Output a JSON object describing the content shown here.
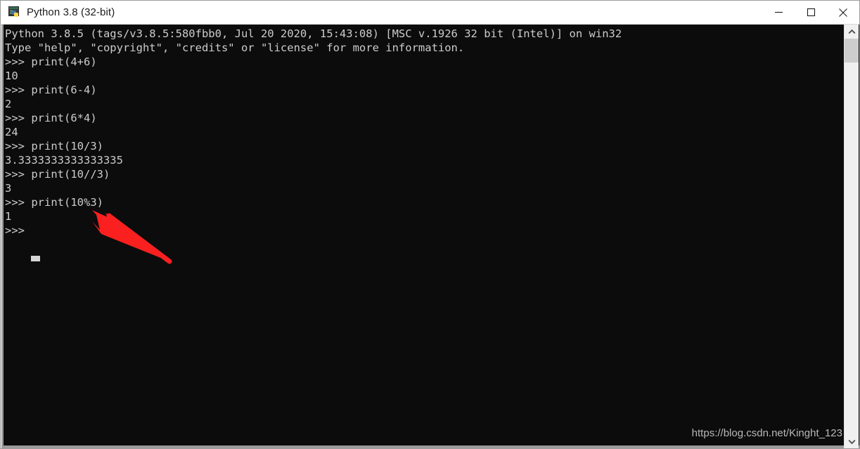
{
  "window": {
    "title": "Python 3.8 (32-bit)",
    "icon": "python-console-icon",
    "controls": {
      "minimize": "minimize-icon",
      "maximize": "maximize-icon",
      "close": "close-icon"
    }
  },
  "console": {
    "background_color": "#0c0c0c",
    "text_color": "#cccccc",
    "lines": [
      "Python 3.8.5 (tags/v3.8.5:580fbb0, Jul 20 2020, 15:43:08) [MSC v.1926 32 bit (Intel)] on win32",
      "Type \"help\", \"copyright\", \"credits\" or \"license\" for more information.",
      ">>> print(4+6)",
      "10",
      ">>> print(6-4)",
      "2",
      ">>> print(6*4)",
      "24",
      ">>> print(10/3)",
      "3.3333333333333335",
      ">>> print(10//3)",
      "3",
      ">>> print(10%3)",
      "1",
      ">>> "
    ],
    "text": "Python 3.8.5 (tags/v3.8.5:580fbb0, Jul 20 2020, 15:43:08) [MSC v.1926 32 bit (Intel)] on win32\nType \"help\", \"copyright\", \"credits\" or \"license\" for more information.\n>>> print(4+6)\n10\n>>> print(6-4)\n2\n>>> print(6*4)\n24\n>>> print(10/3)\n3.3333333333333335\n>>> print(10//3)\n3\n>>> print(10%3)\n1\n>>> ",
    "cursor": "block-cursor"
  },
  "annotation": {
    "arrow_color": "#fa2020",
    "arrow_tip": "140,298",
    "arrow_tail": "237,371"
  },
  "watermark": {
    "text": "https://blog.csdn.net/Kinght_123",
    "color": "#b8b8b8"
  },
  "scrollbar": {
    "up_arrow": "chevron-up-icon",
    "down_arrow": "chevron-down-icon",
    "thumb": "scrollbar-thumb"
  }
}
